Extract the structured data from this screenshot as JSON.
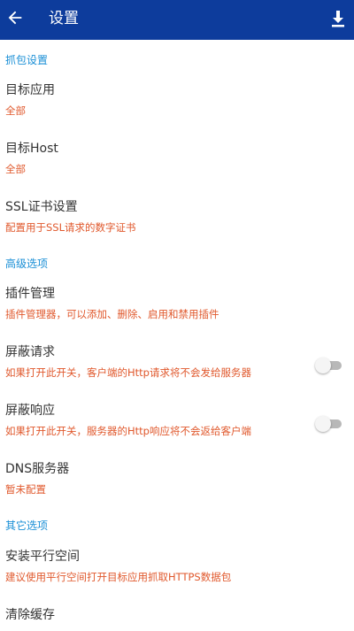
{
  "appbar": {
    "title": "设置",
    "back_icon": "arrow-left-icon",
    "download_icon": "download-icon"
  },
  "sections": {
    "capture": "抓包设置",
    "advanced": "高级选项",
    "other": "其它选项"
  },
  "items": {
    "target_app": {
      "title": "目标应用",
      "subtitle": "全部"
    },
    "target_host": {
      "title": "目标Host",
      "subtitle": "全部"
    },
    "ssl": {
      "title": "SSL证书设置",
      "subtitle": "配置用于SSL请求的数字证书"
    },
    "plugins": {
      "title": "插件管理",
      "subtitle": "插件管理器，可以添加、删除、启用和禁用插件"
    },
    "block_request": {
      "title": "屏蔽请求",
      "subtitle": "如果打开此开关，客户端的Http请求将不会发给服务器",
      "enabled": false
    },
    "block_response": {
      "title": "屏蔽响应",
      "subtitle": "如果打开此开关，服务器的Http响应将不会返给客户端",
      "enabled": false
    },
    "dns": {
      "title": "DNS服务器",
      "subtitle": "暂未配置"
    },
    "parallel_space": {
      "title": "安装平行空间",
      "subtitle": "建议使用平行空间打开目标应用抓取HTTPS数据包"
    },
    "clear_cache": {
      "title": "清除缓存"
    }
  },
  "colors": {
    "appbar": "#0d3c9c",
    "section": "#1a8fd6",
    "subtitle": "#e0582c"
  }
}
